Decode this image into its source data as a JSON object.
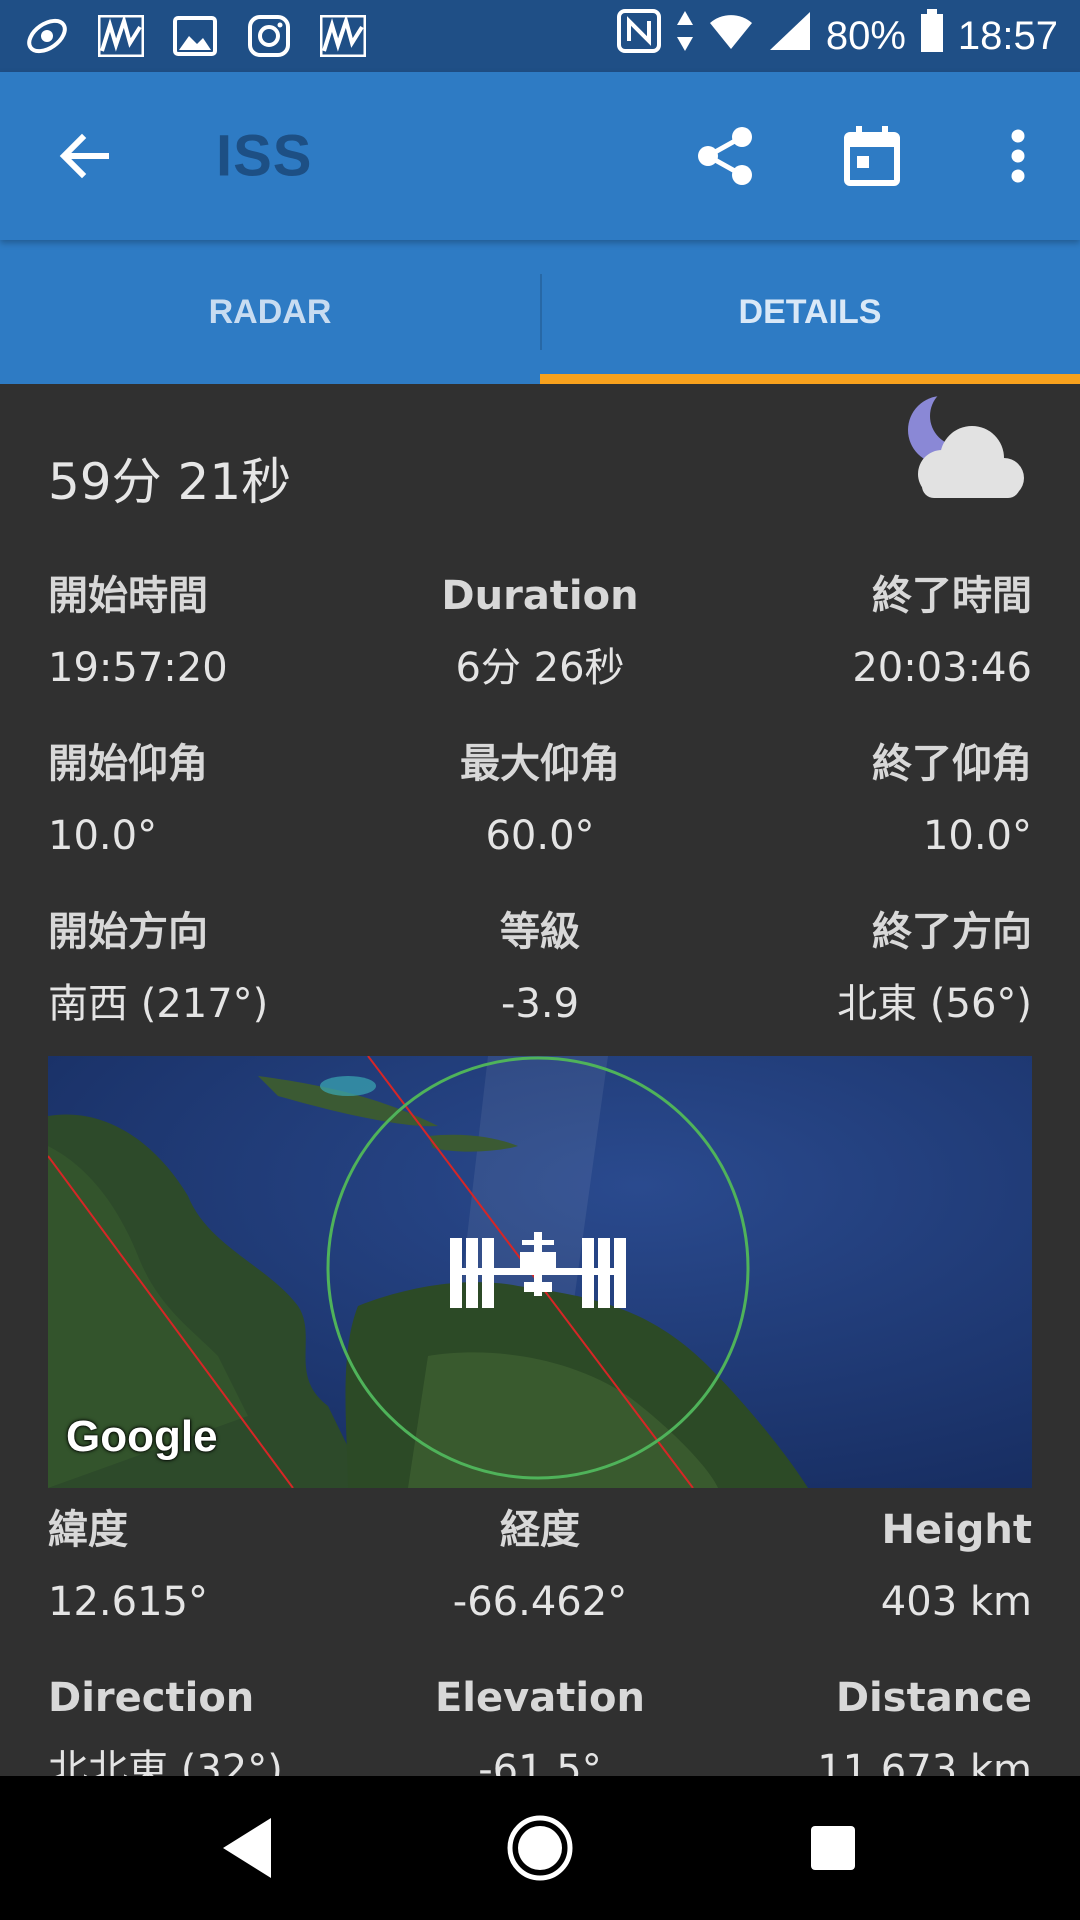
{
  "status_bar": {
    "battery": "80%",
    "time": "18:57"
  },
  "app_bar": {
    "title": "ISS"
  },
  "tabs": [
    {
      "label": "RADAR",
      "selected": false
    },
    {
      "label": "DETAILS",
      "selected": true
    }
  ],
  "pass": {
    "countdown": "59分 21秒",
    "start_time_label": "開始時間",
    "start_time": "19:57:20",
    "duration_label": "Duration",
    "duration": "6分 26秒",
    "end_time_label": "終了時間",
    "end_time": "20:03:46",
    "start_elev_label": "開始仰角",
    "start_elev": "10.0°",
    "max_elev_label": "最大仰角",
    "max_elev": "60.0°",
    "end_elev_label": "終了仰角",
    "end_elev": "10.0°",
    "start_dir_label": "開始方向",
    "start_dir": "南西 (217°)",
    "magnitude_label": "等級",
    "magnitude": "-3.9",
    "end_dir_label": "終了方向",
    "end_dir": "北東 (56°)"
  },
  "map": {
    "attribution": "Google"
  },
  "position": {
    "lat_label": "緯度",
    "lat": "12.615°",
    "lon_label": "経度",
    "lon": "-66.462°",
    "height_label": "Height",
    "height": "403 km",
    "direction_label": "Direction",
    "direction": "北北東 (32°)",
    "elevation_label": "Elevation",
    "elevation": "-61.5°",
    "distance_label": "Distance",
    "distance": "11,673 km"
  },
  "colors": {
    "status_bar": "#1f4f86",
    "app_bar": "#2e7bc4",
    "tab_indicator": "#f7a11d",
    "background": "#303030"
  },
  "icons": {
    "back": "arrow-back-icon",
    "share": "share-icon",
    "calendar": "calendar-icon",
    "overflow": "more-vert-icon",
    "weather": "moon-cloud-icon"
  }
}
